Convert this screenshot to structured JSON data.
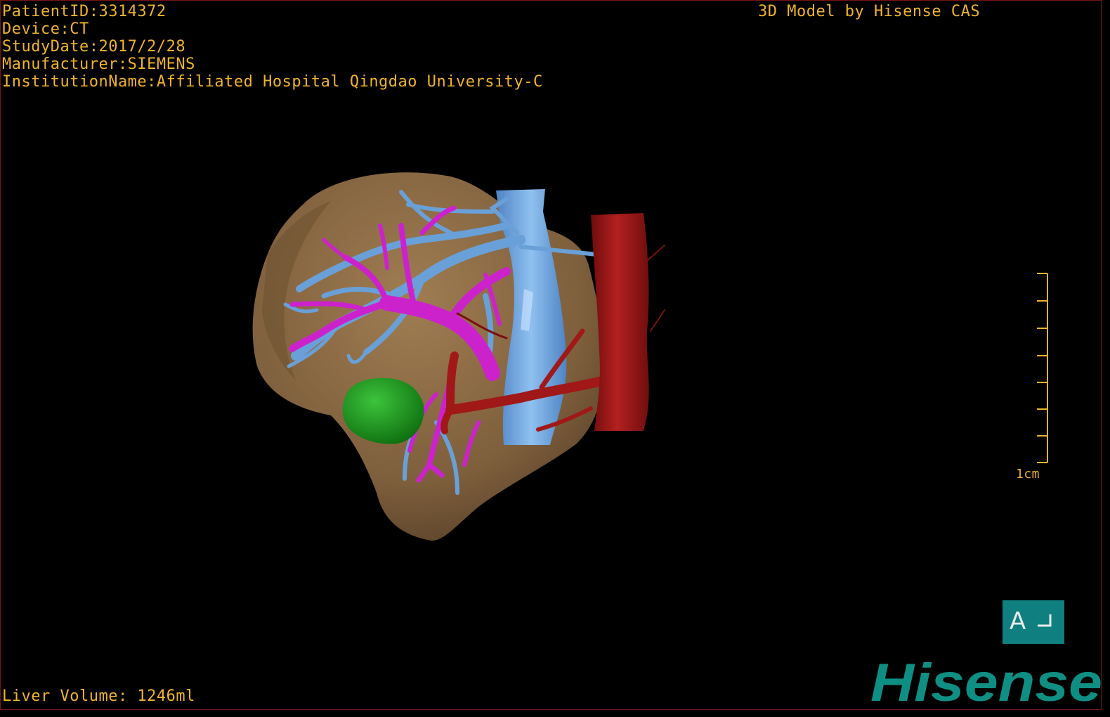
{
  "header": {
    "patient_id": "PatientID:3314372",
    "device": "Device:CT",
    "study_date": "StudyDate:2017/2/28",
    "manufacturer": "Manufacturer:SIEMENS",
    "institution": "InstitutionName:Affiliated Hospital Qingdao University-C"
  },
  "brand_caption": "3D Model by Hisense CAS",
  "footer": {
    "liver_volume": "Liver Volume: 1246ml"
  },
  "scale": {
    "label": "1cm"
  },
  "orientation": {
    "letter": "A"
  },
  "logo": {
    "text": "Hisense"
  },
  "colors": {
    "overlay_text": "#f0b429",
    "liver": "#8b6b45",
    "hepatic_vein": "#6aa0d8",
    "portal_vein": "#cc22cc",
    "artery": "#a01818",
    "tumor": "#1d9a1d",
    "brand": "#0f8f84"
  },
  "icons": {
    "orientation": "orientation-cube-icon",
    "logo": "hisense-logo"
  }
}
